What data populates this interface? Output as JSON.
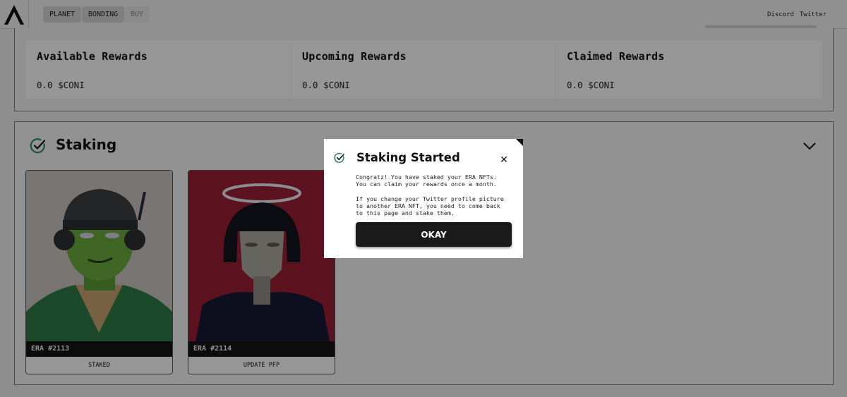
{
  "header": {
    "nav": [
      {
        "label": "PLANET"
      },
      {
        "label": "BONDING"
      },
      {
        "label": "BUY"
      }
    ],
    "links": {
      "discord": "Discord",
      "twitter": "Twitter"
    }
  },
  "rewards": [
    {
      "title": "Available Rewards",
      "value": "0.0 $CONI"
    },
    {
      "title": "Upcoming Rewards",
      "value": "0.0 $CONI"
    },
    {
      "title": "Claimed Rewards",
      "value": "0.0 $CONI"
    }
  ],
  "staking": {
    "title": "Staking",
    "nfts": [
      {
        "name": "ERA #2113",
        "action": "STAKED"
      },
      {
        "name": "ERA #2114",
        "action": "UPDATE PFP"
      }
    ]
  },
  "modal": {
    "title": "Staking Started",
    "line1": "Congratz! You have staked your ERA NFTs.",
    "line2": "You can claim your rewards once a month.",
    "line3": "If you change your Twitter profile picture",
    "line4": "to another ERA NFT, you need to come back",
    "line5": "to this page and stake them.",
    "button": "OKAY"
  },
  "colors": {
    "accent_green": "#2f8a67",
    "button_dark": "#1b1b1b"
  }
}
